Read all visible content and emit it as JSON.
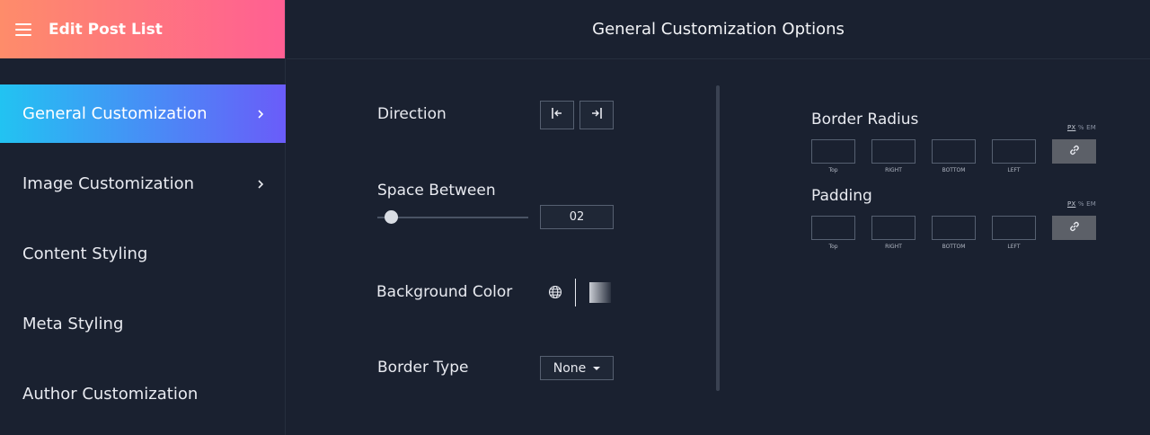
{
  "sidebar": {
    "title": "Edit Post List",
    "menu_icon": "hamburger-menu-icon",
    "items": [
      {
        "label": "General Customization",
        "has_chevron": true,
        "active": true
      },
      {
        "label": "Image Customization",
        "has_chevron": true,
        "active": false
      },
      {
        "label": "Content Styling",
        "has_chevron": false,
        "active": false
      },
      {
        "label": "Meta Styling",
        "has_chevron": false,
        "active": false
      },
      {
        "label": "Author Customization",
        "has_chevron": false,
        "active": false
      }
    ]
  },
  "main": {
    "title": "General Customization Options",
    "direction": {
      "label": "Direction",
      "options": [
        "align-start-icon",
        "align-end-icon"
      ]
    },
    "space_between": {
      "label": "Space Between",
      "value": "02",
      "slider_level": 0.05
    },
    "background_color": {
      "label": "Background Color",
      "icons": [
        "globe-icon"
      ]
    },
    "border_type": {
      "label": "Border Type",
      "value": "None"
    },
    "border_radius": {
      "title": "Border Radius",
      "units": [
        "PX",
        "%",
        "EM"
      ],
      "active_unit": "PX",
      "fields": [
        "Top",
        "RIGHT",
        "BOTTOM",
        "LEFT"
      ]
    },
    "padding": {
      "title": "Padding",
      "units": [
        "PX",
        "%",
        "EM"
      ],
      "active_unit": "PX",
      "fields": [
        "Top",
        "RIGHT",
        "BOTTOM",
        "LEFT"
      ]
    }
  },
  "colors": {
    "header_gradient": [
      "#fe8c6a",
      "#ff5f93"
    ],
    "active_gradient": [
      "#22c3f2",
      "#6a5cf9"
    ],
    "background": "#1a2130"
  }
}
